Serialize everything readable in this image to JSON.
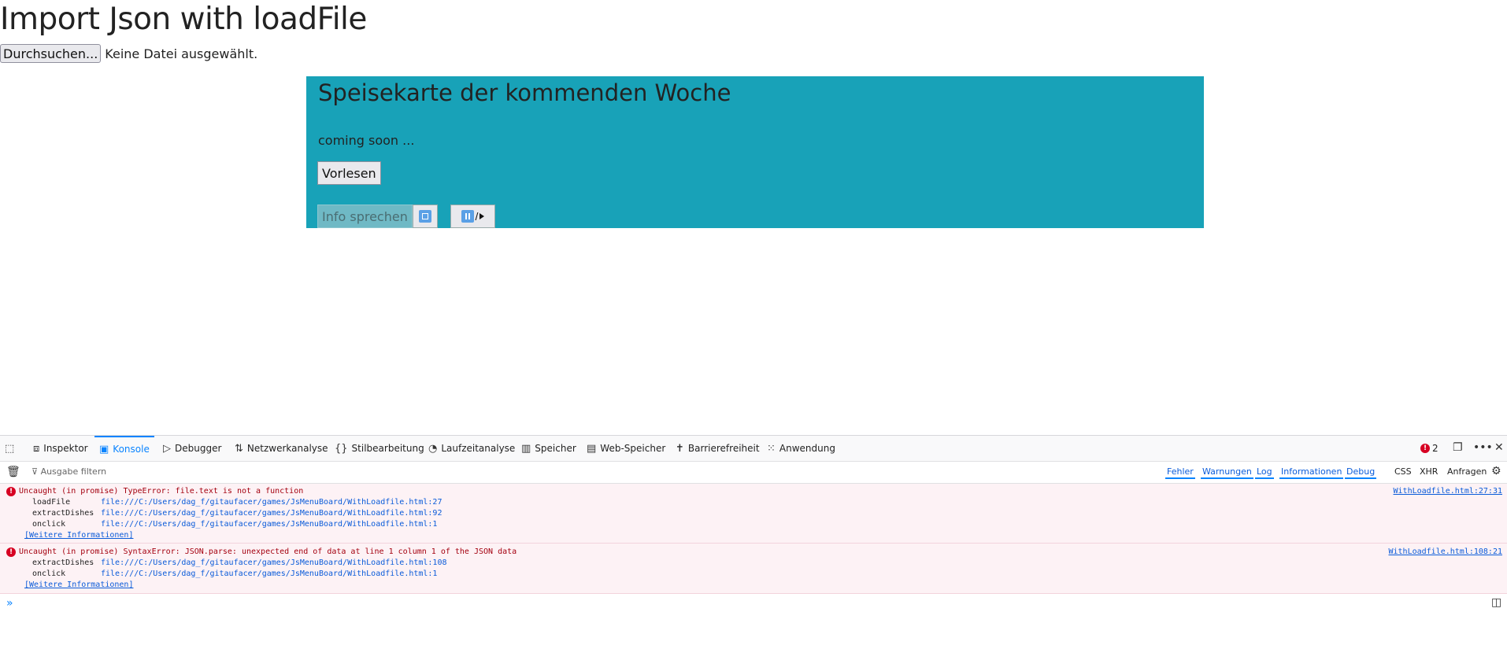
{
  "page": {
    "title": "Import Json with loadFile",
    "file_button": "Durchsuchen...",
    "file_status": "Keine Datei ausgewählt."
  },
  "menu": {
    "title": "Speisekarte der kommenden Woche",
    "coming_soon": "coming soon ...",
    "read_button": "Vorlesen",
    "info_button": "Info sprechen",
    "play_pause_separator": "/"
  },
  "devtools": {
    "tabs": [
      {
        "label": "Inspektor",
        "icon": "inspector-icon"
      },
      {
        "label": "Konsole",
        "icon": "console-icon"
      },
      {
        "label": "Debugger",
        "icon": "debugger-icon"
      },
      {
        "label": "Netzwerkanalyse",
        "icon": "network-icon"
      },
      {
        "label": "Stilbearbeitung",
        "icon": "style-editor-icon"
      },
      {
        "label": "Laufzeitanalyse",
        "icon": "performance-icon"
      },
      {
        "label": "Speicher",
        "icon": "memory-icon"
      },
      {
        "label": "Web-Speicher",
        "icon": "storage-icon"
      },
      {
        "label": "Barrierefreiheit",
        "icon": "accessibility-icon"
      },
      {
        "label": "Anwendung",
        "icon": "application-icon"
      }
    ],
    "active_tab": "Konsole",
    "error_count": "2",
    "filter_placeholder": "Ausgabe filtern",
    "filter_buttons": [
      "Fehler",
      "Warnungen",
      "Log",
      "Informationen",
      "Debug"
    ],
    "filter_extra": [
      "CSS",
      "XHR",
      "Anfragen"
    ],
    "messages": [
      {
        "text": "Uncaught (in promise) TypeError: file.text is not a function",
        "source": "WithLoadfile.html:27:31",
        "trace": [
          {
            "fn": "loadFile",
            "loc": "file:///C:/Users/dag_f/gitaufacer/games/JsMenuBoard/WithLoadfile.html:27"
          },
          {
            "fn": "extractDishes",
            "loc": "file:///C:/Users/dag_f/gitaufacer/games/JsMenuBoard/WithLoadfile.html:92"
          },
          {
            "fn": "onclick",
            "loc": "file:///C:/Users/dag_f/gitaufacer/games/JsMenuBoard/WithLoadfile.html:1"
          }
        ],
        "more": "[Weitere Informationen]"
      },
      {
        "text": "Uncaught (in promise) SyntaxError: JSON.parse: unexpected end of data at line 1 column 1 of the JSON data",
        "source": "WithLoadfile.html:108:21",
        "trace": [
          {
            "fn": "extractDishes",
            "loc": "file:///C:/Users/dag_f/gitaufacer/games/JsMenuBoard/WithLoadfile.html:108"
          },
          {
            "fn": "onclick",
            "loc": "file:///C:/Users/dag_f/gitaufacer/games/JsMenuBoard/WithLoadfile.html:1"
          }
        ],
        "more": "[Weitere Informationen]"
      }
    ],
    "prompt_symbol": "»"
  },
  "colors": {
    "panel": "#18a2b8",
    "accent": "#0a84ff",
    "error": "#a4000f",
    "error_bg": "#fdf2f5"
  }
}
